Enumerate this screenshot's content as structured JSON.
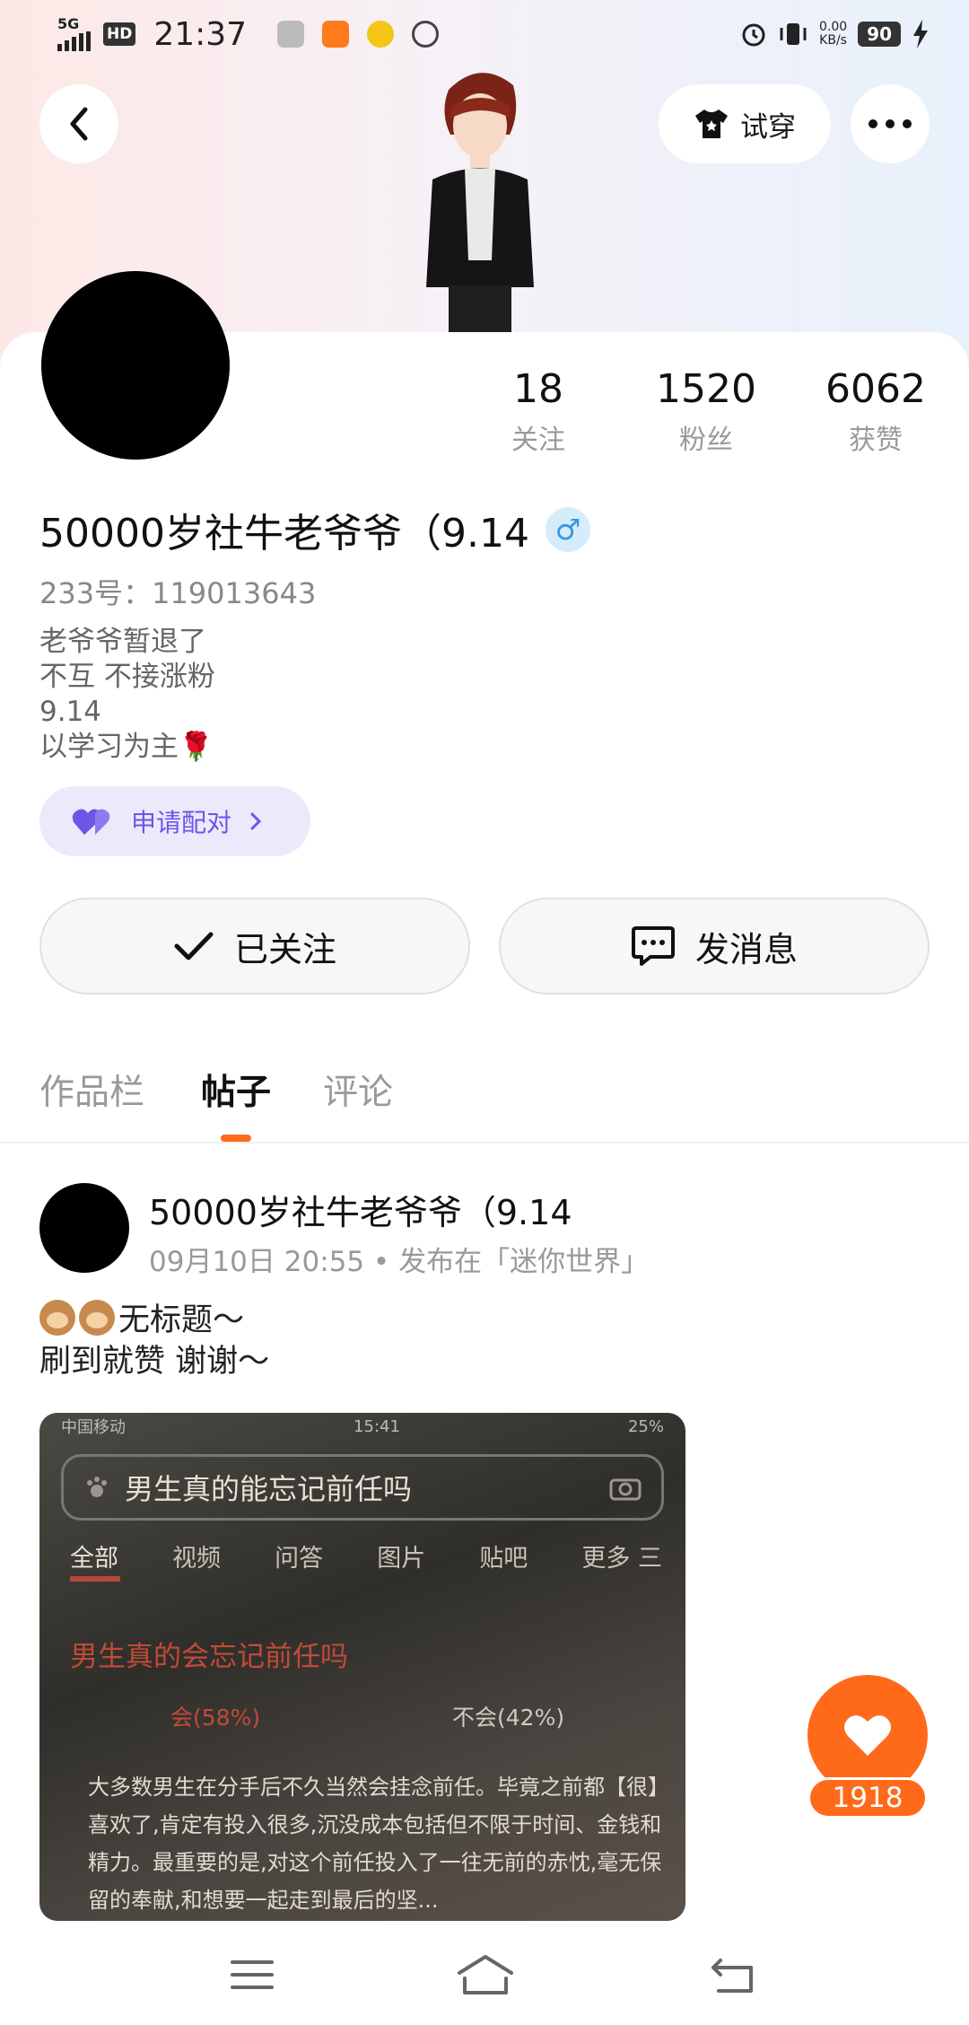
{
  "status_bar": {
    "network": "5G",
    "hd": "HD",
    "time": "21:37",
    "speed_value": "0.00",
    "speed_unit": "KB/s",
    "battery": "90"
  },
  "header": {
    "try_on_label": "试穿"
  },
  "profile": {
    "stats": [
      {
        "value": "18",
        "label": "关注"
      },
      {
        "value": "1520",
        "label": "粉丝"
      },
      {
        "value": "6062",
        "label": "获赞"
      }
    ],
    "nickname": "50000岁社牛老爷爷（9.14",
    "gender_symbol": "♂",
    "user_id": "233号：119013643",
    "bio_lines": [
      "老爷爷暂退了",
      "不互 不接涨粉",
      "9.14",
      "以学习为主🌹"
    ],
    "match_label": "申请配对"
  },
  "actions": {
    "follow_label": "已关注",
    "message_label": "发消息"
  },
  "tabs": [
    {
      "label": "作品栏"
    },
    {
      "label": "帖子"
    },
    {
      "label": "评论"
    }
  ],
  "post": {
    "author": "50000岁社牛老爷爷（9.14",
    "meta": "09月10日 20:55 • 发布在「迷你世界」",
    "title_line1": "无标题～",
    "title_line2": "刷到就赞 谢谢～",
    "image": {
      "carrier": "中国移动",
      "time": "15:41",
      "battery": "25%",
      "search_text": "男生真的能忘记前任吗",
      "tabs": [
        "全部",
        "视频",
        "问答",
        "图片",
        "贴吧",
        "更多 三"
      ],
      "question": "男生真的会忘记前任吗",
      "option_a": "会(58%)",
      "option_b": "不会(42%)",
      "body": "大多数男生在分手后不久当然会挂念前任。毕竟之前都【很】喜欢了,肯定有投入很多,沉没成本包括但不限于时间、金钱和精力。最重要的是,对这个前任投入了一往无前的赤忱,毫无保留的奉献,和想要一起走到最后的坚..."
    }
  },
  "like": {
    "count": "1918",
    "color": "#ff6a1a"
  },
  "colors": {
    "accent": "#ff6b17",
    "match_purple": "#6b56e6"
  }
}
